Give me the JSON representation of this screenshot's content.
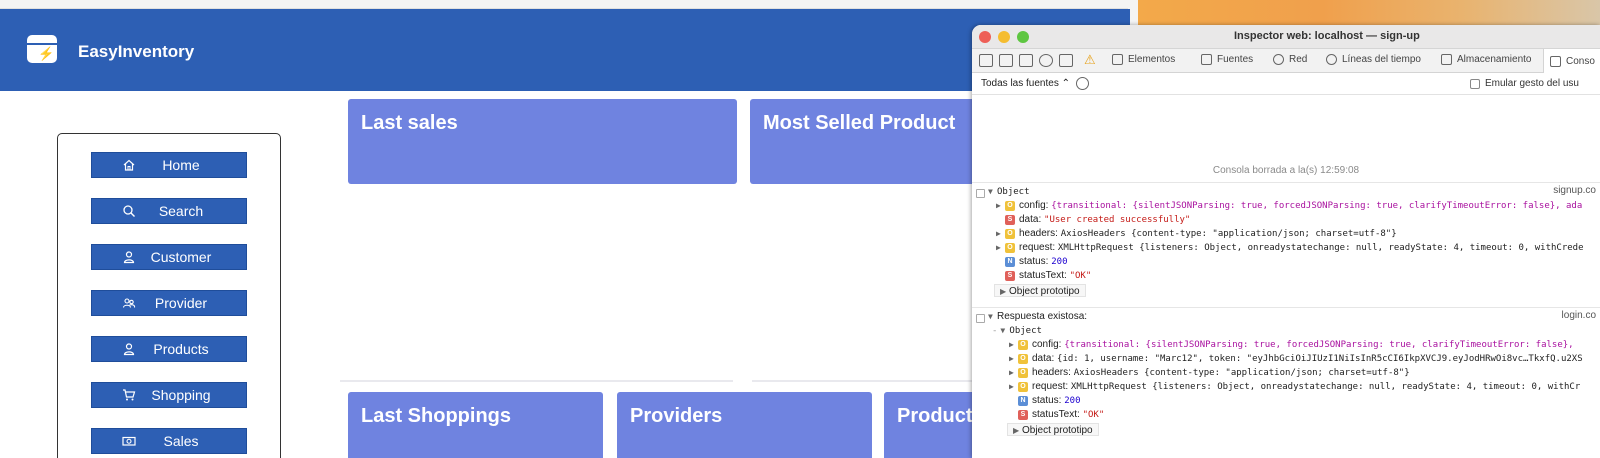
{
  "app": {
    "title": "EasyInventory",
    "nav": [
      {
        "label": "Home",
        "icon": "home-icon"
      },
      {
        "label": "Search",
        "icon": "search-icon"
      },
      {
        "label": "Customer",
        "icon": "user-icon"
      },
      {
        "label": "Provider",
        "icon": "users-icon"
      },
      {
        "label": "Products",
        "icon": "user-icon"
      },
      {
        "label": "Shopping",
        "icon": "cart-icon"
      },
      {
        "label": "Sales",
        "icon": "money-icon"
      }
    ],
    "cards": {
      "last_sales": "Last sales",
      "most_selled": "Most Selled Product",
      "last_shoppings": "Last Shoppings",
      "providers": "Providers",
      "products": "Product"
    },
    "colors": {
      "header": "#2d5fb4",
      "card": "#6f83e0"
    }
  },
  "inspector": {
    "title": "Inspector web: localhost — sign-up",
    "tabs": [
      "Elementos",
      "Fuentes",
      "Red",
      "Líneas del tiempo",
      "Almacenamiento",
      "Conso"
    ],
    "filter_label": "Todas las fuentes ⌃",
    "emular_label": "Emular gesto del usu",
    "cleared_text": "Consola borrada a la(s) 12:59:08",
    "log1": {
      "label": "Object",
      "source": "signup.co",
      "config": "{transitional: {silentJSONParsing: true, forcedJSONParsing: true, clarifyTimeoutError: false}, ada",
      "data": "\"User created successfully\"",
      "headers": "AxiosHeaders {content-type: \"application/json; charset=utf-8\"}",
      "request": "XMLHttpRequest {listeners: Object, onreadystatechange: null, readyState: 4, timeout: 0, withCrede",
      "status": "200",
      "statusText": "\"OK\"",
      "proto": "Object prototipo"
    },
    "log2": {
      "label": "Respuesta existosa:",
      "source": "login.co",
      "object_label": "Object",
      "config": "{transitional: {silentJSONParsing: true, forcedJSONParsing: true, clarifyTimeoutError: false},",
      "data": "{id: 1, username: \"Marc12\", token: \"eyJhbGciOiJIUzI1NiIsInR5cCI6IkpXVCJ9.eyJodHRwOi8vc…TkxfQ.u2XS",
      "headers": "AxiosHeaders {content-type: \"application/json; charset=utf-8\"}",
      "request": "XMLHttpRequest {listeners: Object, onreadystatechange: null, readyState: 4, timeout: 0, withCr",
      "status": "200",
      "statusText": "\"OK\"",
      "proto": "Object prototipo"
    }
  }
}
